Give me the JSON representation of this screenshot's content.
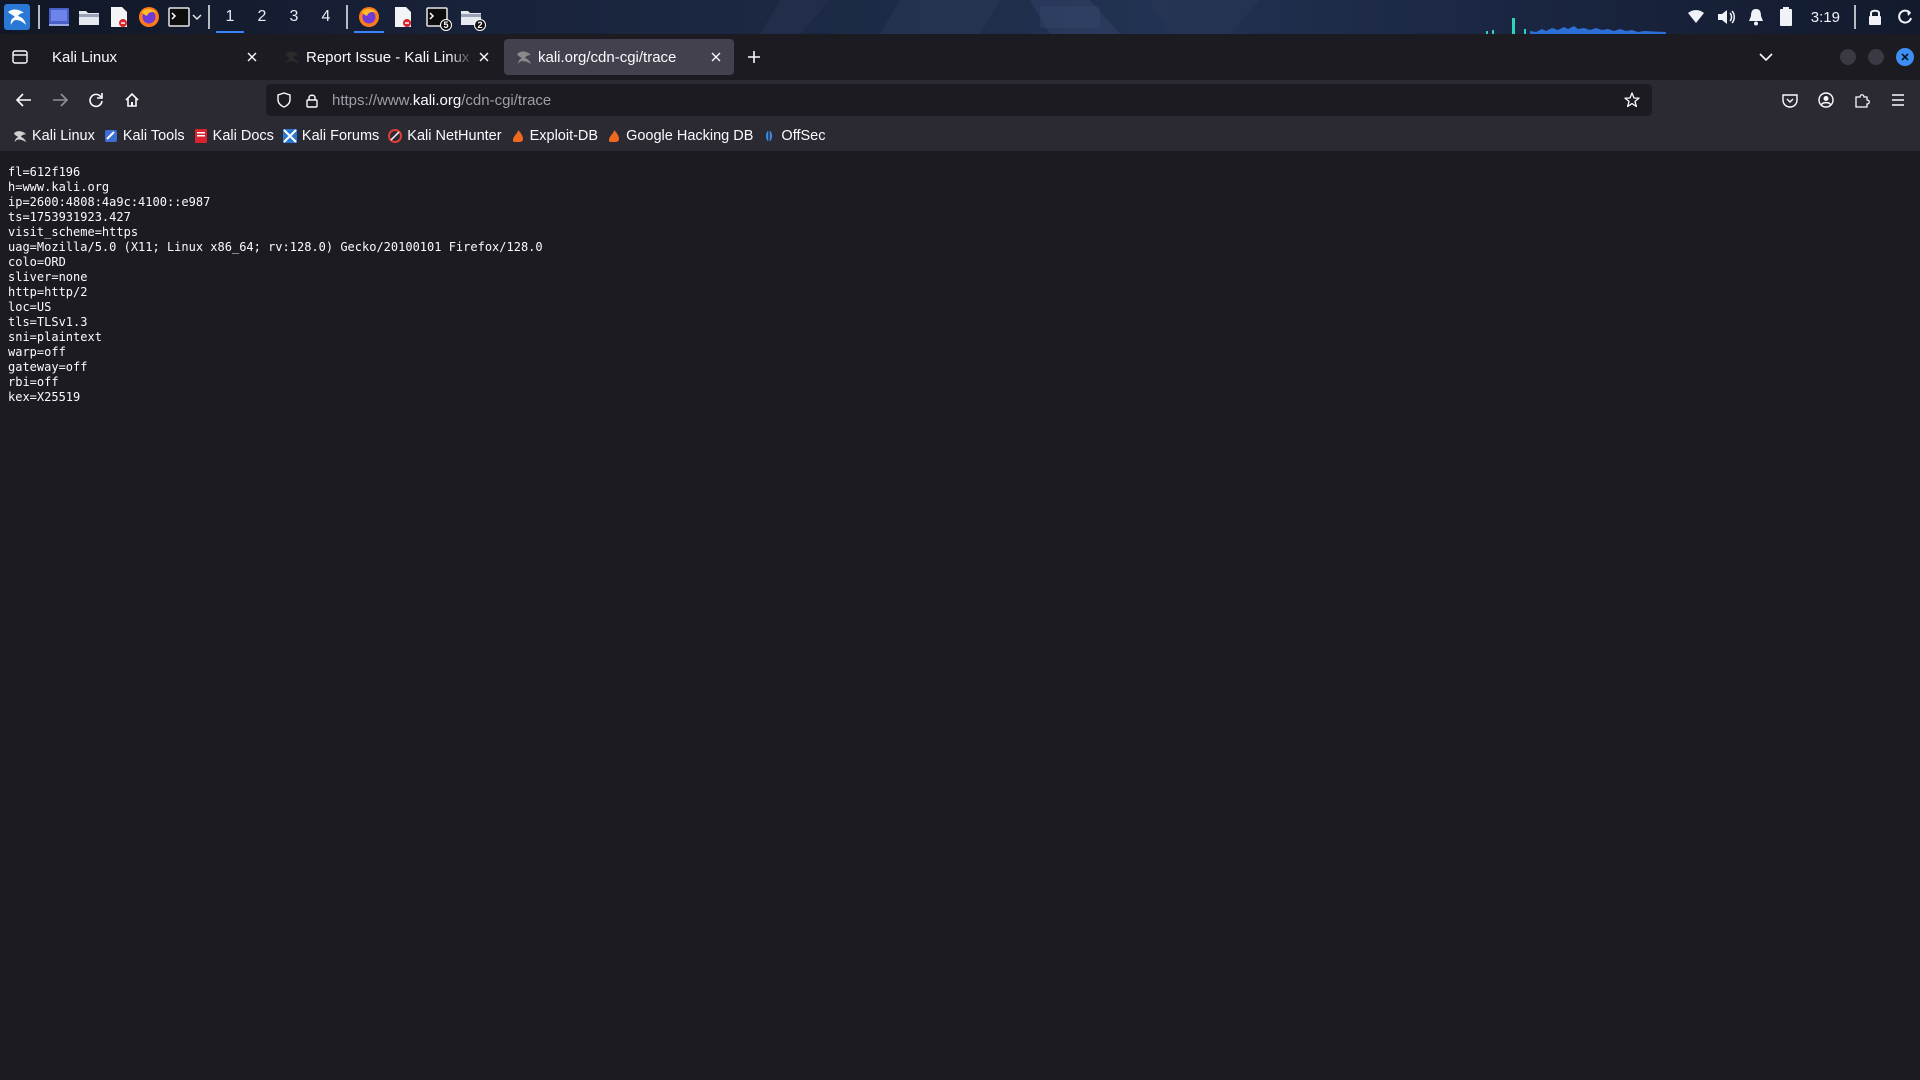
{
  "panel": {
    "workspaces": [
      "1",
      "2",
      "3",
      "4"
    ],
    "active_workspace": "1",
    "taskbar": [
      {
        "icon": "firefox-icon",
        "active": true
      },
      {
        "icon": "text-editor-icon",
        "active": false
      },
      {
        "icon": "terminal-icon",
        "badge": "5"
      },
      {
        "icon": "file-manager-icon",
        "badge": "2"
      }
    ],
    "clock": "3:19"
  },
  "tabs": [
    {
      "title": "Kali Linux",
      "favicon": "none",
      "selected": false
    },
    {
      "title": "Report Issue - Kali Linux Bug Tracker",
      "favicon": "kali-dragon-icon",
      "selected": false
    },
    {
      "title": "kali.org/cdn-cgi/trace",
      "favicon": "kali-dragon-icon",
      "selected": true
    }
  ],
  "urlbar": {
    "prefix": "https://www.",
    "domain": "kali.org",
    "path": "/cdn-cgi/trace"
  },
  "bookmarks": [
    {
      "label": "Kali Linux",
      "icon": "kali-dragon-icon"
    },
    {
      "label": "Kali Tools",
      "icon": "kali-tools-icon"
    },
    {
      "label": "Kali Docs",
      "icon": "kali-docs-icon"
    },
    {
      "label": "Kali Forums",
      "icon": "kali-forums-icon"
    },
    {
      "label": "Kali NetHunter",
      "icon": "nethunter-icon"
    },
    {
      "label": "Exploit-DB",
      "icon": "exploit-db-icon"
    },
    {
      "label": "Google Hacking DB",
      "icon": "ghdb-icon"
    },
    {
      "label": "OffSec",
      "icon": "offsec-icon"
    }
  ],
  "trace_lines": [
    "fl=612f196",
    "h=www.kali.org",
    "ip=2600:4808:4a9c:4100::e987",
    "ts=1753931923.427",
    "visit_scheme=https",
    "uag=Mozilla/5.0 (X11; Linux x86_64; rv:128.0) Gecko/20100101 Firefox/128.0",
    "colo=ORD",
    "sliver=none",
    "http=http/2",
    "loc=US",
    "tls=TLSv1.3",
    "sni=plaintext",
    "warp=off",
    "gateway=off",
    "rbi=off",
    "kex=X25519"
  ],
  "colors": {
    "content_bg": "#1c1b22",
    "toolbar_bg": "#2b2a33",
    "selected_tab_bg": "#42414d",
    "accent": "#3b82f6"
  }
}
